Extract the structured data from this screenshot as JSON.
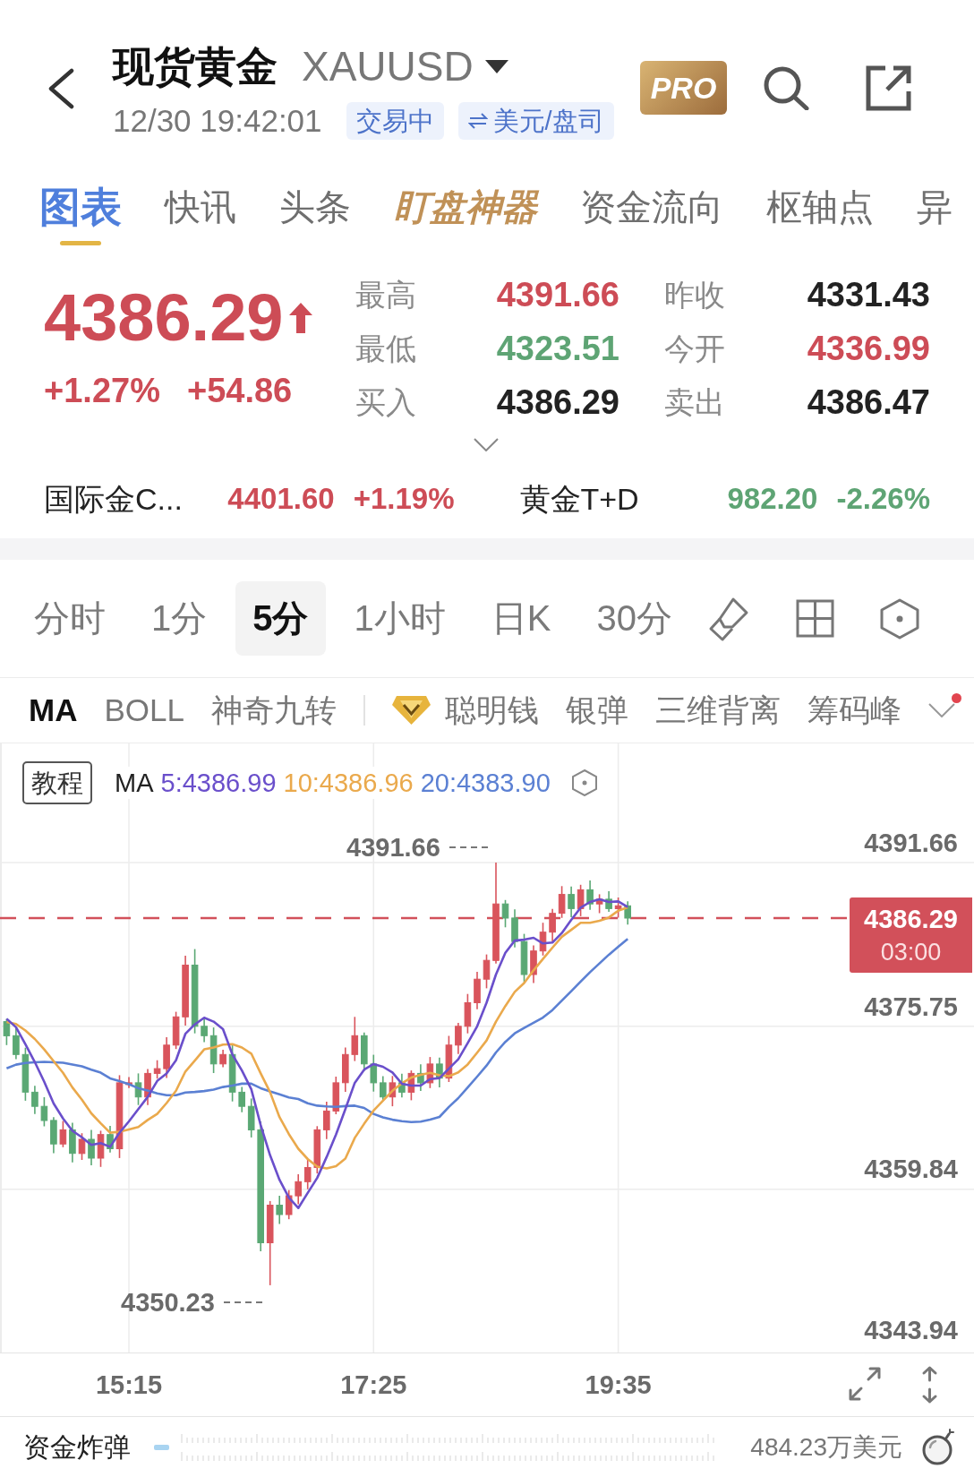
{
  "header": {
    "title": "现货黄金",
    "symbol": "XAUUSD",
    "timestamp": "12/30 19:42:01",
    "badges": [
      {
        "kind": "status",
        "text": "交易中"
      },
      {
        "kind": "unit",
        "text": "美元/盘司"
      }
    ],
    "pro_badge": "PRO"
  },
  "tabs": [
    {
      "label": "图表",
      "kind": "plain",
      "selected": true
    },
    {
      "label": "快讯",
      "kind": "plain",
      "selected": false
    },
    {
      "label": "头条",
      "kind": "plain",
      "selected": false
    },
    {
      "label": "盯盘神器",
      "kind": "featured",
      "selected": false
    },
    {
      "label": "资金流向",
      "kind": "plain",
      "selected": false
    },
    {
      "label": "枢轴点",
      "kind": "plain",
      "selected": false
    },
    {
      "label": "异",
      "kind": "plain",
      "selected": false
    }
  ],
  "quote": {
    "price": "4386.29",
    "rising": true,
    "color": "#cd4c56",
    "change_percent": "+1.27%",
    "change": "+54.86",
    "stats": [
      {
        "label": "最高",
        "value": "4391.66",
        "color": "#cd4c56"
      },
      {
        "label": "昨收",
        "value": "4331.43",
        "color": "#222222"
      },
      {
        "label": "最低",
        "value": "4323.51",
        "color": "#5ea474"
      },
      {
        "label": "今开",
        "value": "4336.99",
        "color": "#cd4c56"
      },
      {
        "label": "买入",
        "value": "4386.29",
        "color": "#222222"
      },
      {
        "label": "卖出",
        "value": "4386.47",
        "color": "#222222"
      }
    ]
  },
  "related": [
    {
      "name": "国际金C...",
      "price": "4401.60",
      "change": "+1.19%",
      "color": "#cd4c56"
    },
    {
      "name": "黄金T+D",
      "price": "982.20",
      "change": "-2.26%",
      "color": "#5ea474"
    }
  ],
  "timeframes": [
    {
      "label": "分时",
      "selected": false
    },
    {
      "label": "1分",
      "selected": false
    },
    {
      "label": "5分",
      "selected": true
    },
    {
      "label": "1小时",
      "selected": false
    },
    {
      "label": "日K",
      "selected": false
    },
    {
      "label": "30分",
      "selected": false
    }
  ],
  "indicators": [
    {
      "label": "MA",
      "kind": "plain",
      "selected": true
    },
    {
      "label": "BOLL",
      "kind": "plain",
      "selected": false
    },
    {
      "label": "神奇九转",
      "kind": "plain",
      "selected": false
    },
    {
      "label": "聪明钱",
      "kind": "premium",
      "selected": false
    },
    {
      "label": "银弹",
      "kind": "plain",
      "selected": false
    },
    {
      "label": "三维背离",
      "kind": "plain",
      "selected": false
    },
    {
      "label": "筹码峰",
      "kind": "plain",
      "selected": false
    }
  ],
  "indicator_menu": {
    "notification": true
  },
  "chart": {
    "guide_button": "教程",
    "legend_title": "MA",
    "legend": [
      {
        "text": "5:4386.99",
        "color": "#6a4fcb"
      },
      {
        "text": "10:4386.96",
        "color": "#eaa94c"
      },
      {
        "text": "20:4383.90",
        "color": "#5b80d3"
      }
    ],
    "high_label": "4391.66",
    "low_label": "4350.23",
    "y_labels": [
      "4391.66",
      "4375.75",
      "4359.84",
      "4343.94"
    ],
    "last_price": "4386.29",
    "countdown": "03:00",
    "x_labels": [
      "15:15",
      "17:25",
      "19:35"
    ]
  },
  "fund_bar": {
    "title": "资金炸弹",
    "amount": "484.23万美元"
  }
}
